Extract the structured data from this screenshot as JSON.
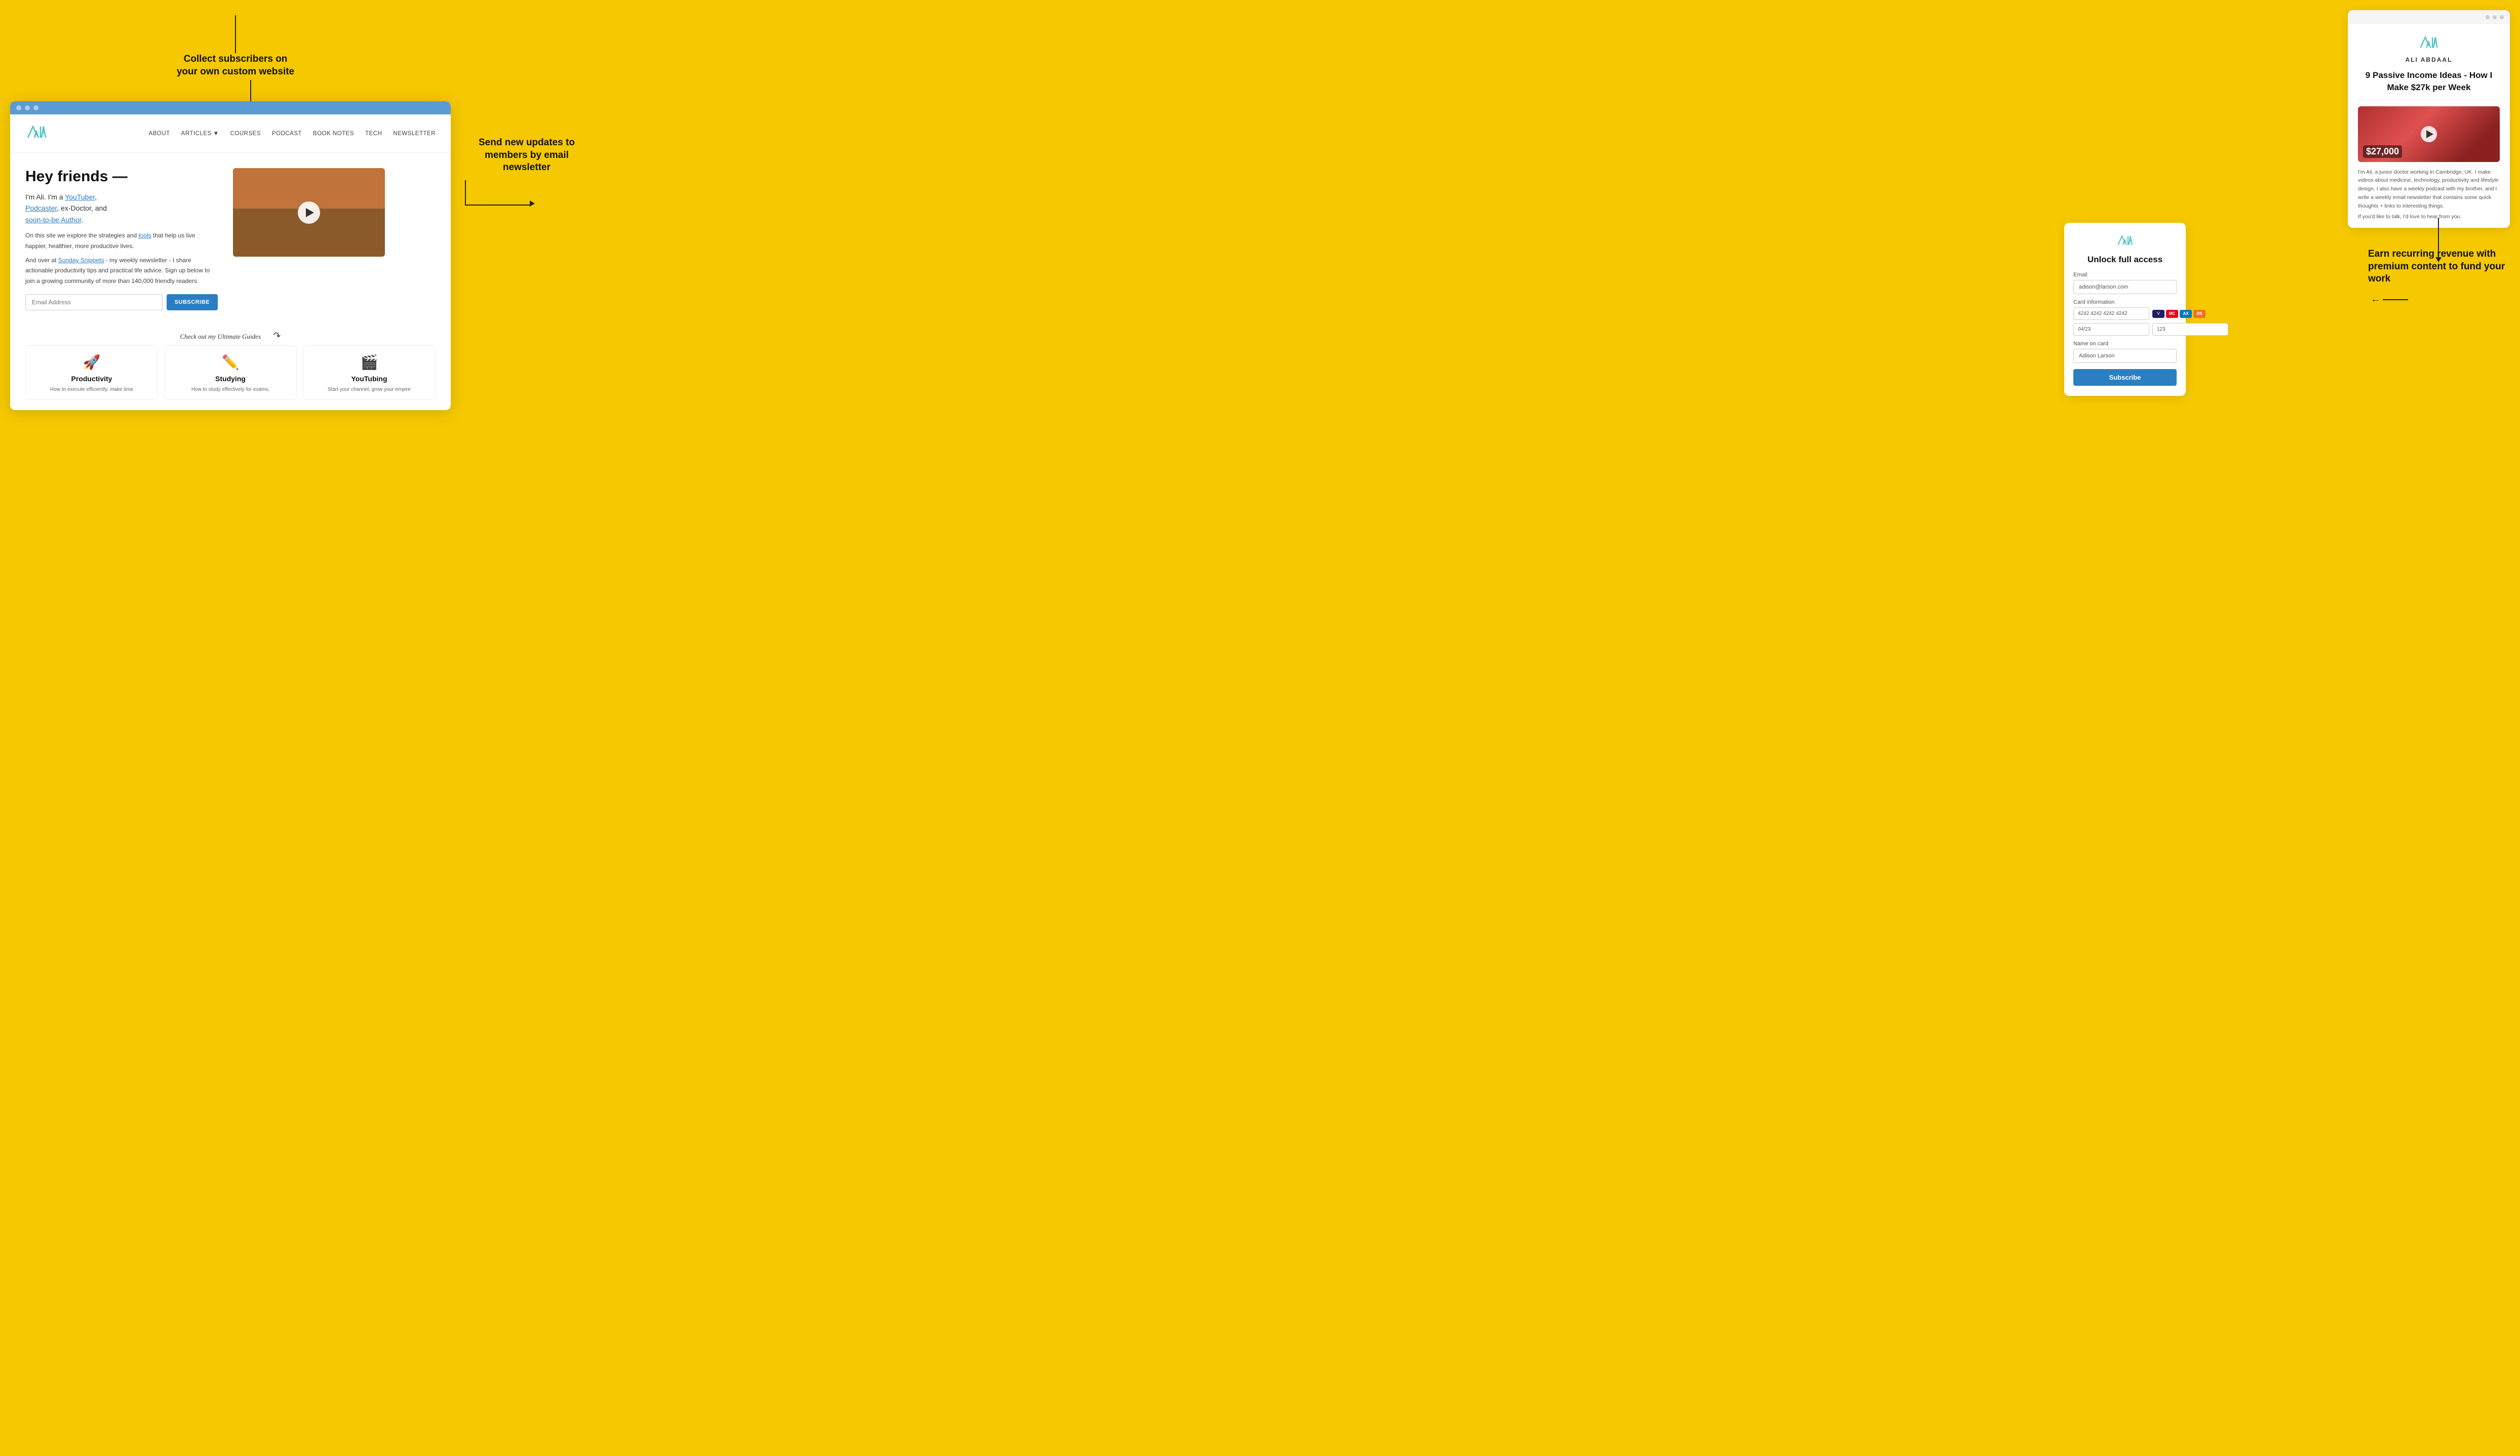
{
  "background_color": "#F5C800",
  "annotation_collect": {
    "label": "Collect subscribers on your own custom website"
  },
  "annotation_email": {
    "label": "Send new updates to members by email newsletter"
  },
  "annotation_revenue": {
    "label": "Earn recurring revenue with premium content to fund your work"
  },
  "browser": {
    "nav": {
      "about": "ABOUT",
      "articles": "ARTICLES",
      "courses": "COURSES",
      "podcast": "PODCAST",
      "book_notes": "BOOK NOTES",
      "tech": "TECH",
      "newsletter": "NEWSLETTER"
    },
    "hero": {
      "title": "Hey friends —",
      "line1": "I'm Ali. I'm a ",
      "youtuber": "YouTuber",
      "comma1": ",",
      "line2": "Podcaster",
      "comma2": ", ex-Doctor, and",
      "line3": "soon-to-be Author",
      "period": ".",
      "text1_pre": "On this site we explore the strategies and ",
      "tools_link": "tools",
      "text1_post": " that help us live happier, healthier, more productive lives.",
      "text2_pre": "And over at ",
      "sunday_snippets": "Sunday Snippets",
      "text2_post": " - my weekly newsletter - I share actionable productivity tips and practical life advice. Sign up below to join a growing community of more than 140,000 friendly readers.",
      "email_placeholder": "Email Address",
      "subscribe_btn": "SUBSCRIBE"
    },
    "guides": {
      "title": "Check out my Ultimate Guides",
      "cards": [
        {
          "icon": "🚀",
          "title": "Productivity",
          "desc": "How to execute efficiently, make time"
        },
        {
          "icon": "✏️",
          "title": "Studying",
          "desc": "How to study effectively for exams,"
        },
        {
          "icon": "🎬",
          "title": "YouTubing",
          "desc": "Start your channel, grow your empire"
        }
      ]
    }
  },
  "ali_card": {
    "name": "ALI ABDAAL",
    "title": "9 Passive Income Ideas - How I Make $27k per Week",
    "video_amount": "$27,000",
    "description": "I'm Ali, a junior doctor working in Cambridge, UK. I make videos about medicine, technology, productivity and lifestyle design. I also have a weekly podcast with my brother, and I write a weekly email newsletter that contains some quick thoughts + links to interesting things.",
    "link_text": "If you'd like to talk, I'd love to hear from you."
  },
  "unlock_card": {
    "title": "Unlock full access",
    "email_label": "Email",
    "email_value": "adison@larson.com",
    "card_label": "Card information",
    "card_number": "4242 4242 4242 4242",
    "expiry": "04/23",
    "cvv": "123",
    "name_label": "Name on card",
    "name_value": "Adison Larson",
    "subscribe_btn": "Subscribe",
    "card_icons": [
      "VISA",
      "MC",
      "AX",
      "DS"
    ]
  }
}
